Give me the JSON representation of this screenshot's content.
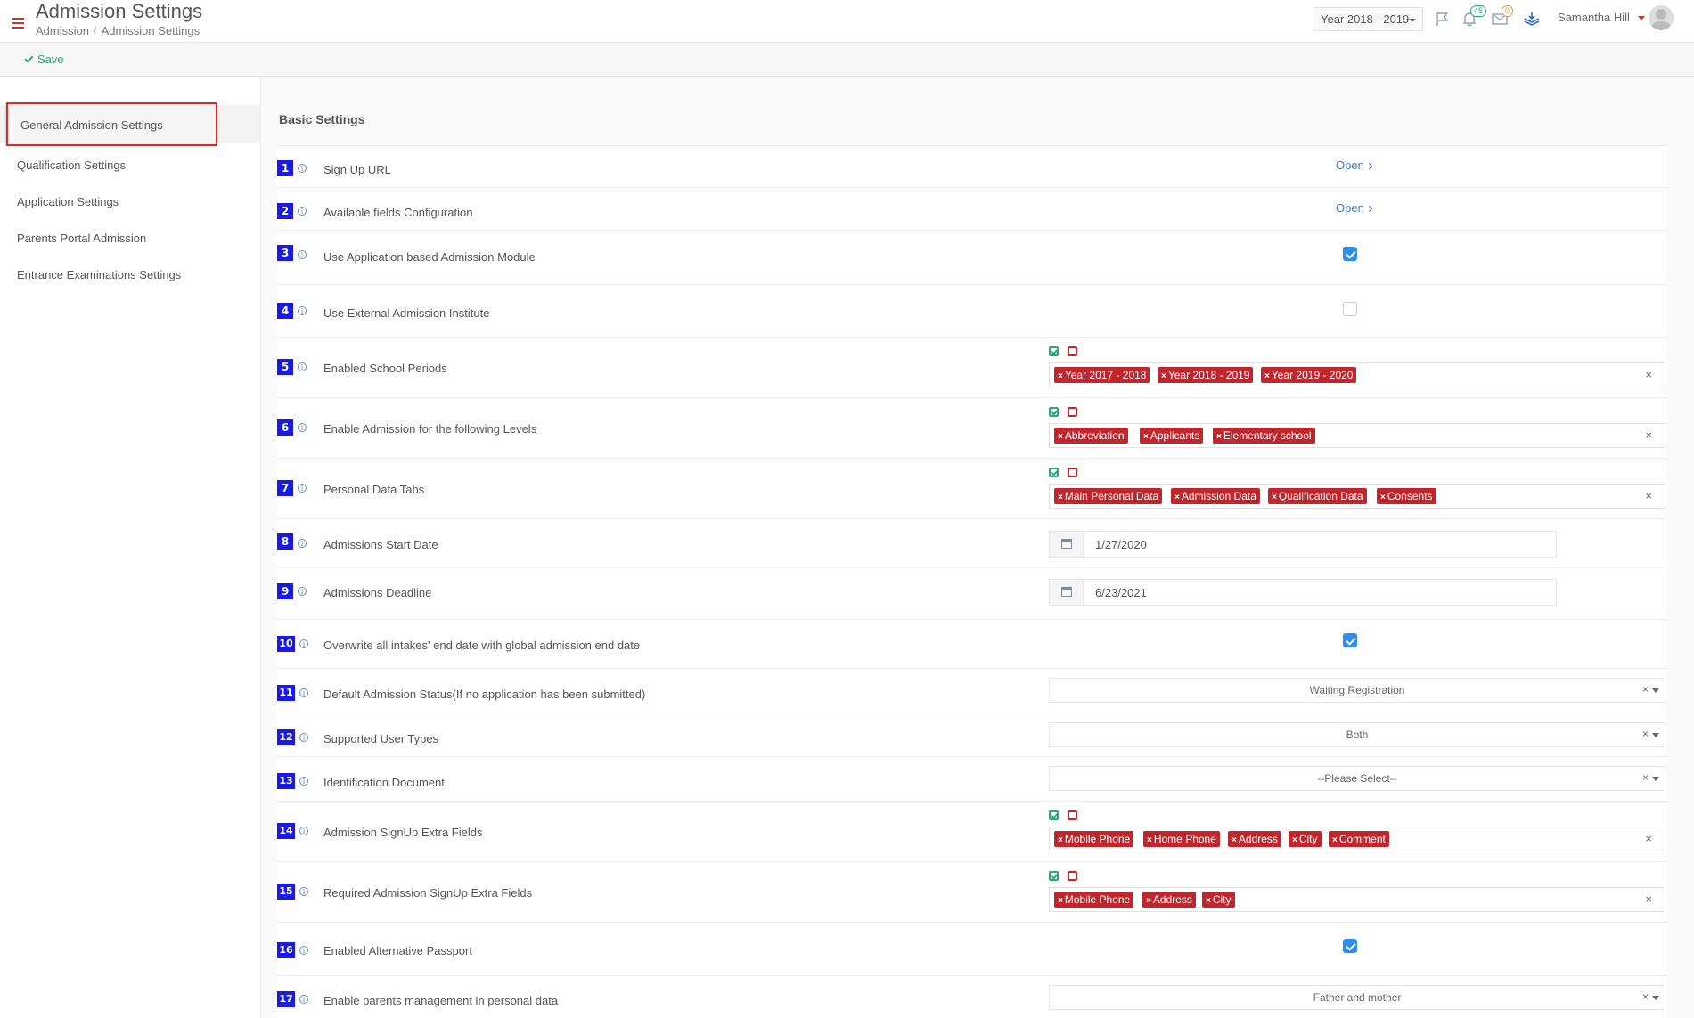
{
  "header": {
    "title": "Admission Settings",
    "breadcrumb": [
      "Admission",
      "Admission Settings"
    ],
    "year_select": "Year 2018 - 2019",
    "notifications_count": "45",
    "messages_count": "0",
    "user_name": "Samantha Hill"
  },
  "toolbar": {
    "save_label": "Save"
  },
  "sidebar": {
    "items": [
      {
        "label": "General Admission Settings"
      },
      {
        "label": "Qualification Settings"
      },
      {
        "label": "Application Settings"
      },
      {
        "label": "Parents Portal Admission"
      },
      {
        "label": "Entrance Examinations Settings"
      }
    ]
  },
  "main": {
    "section_title": "Basic Settings",
    "open_label": "Open",
    "rows": [
      {
        "num": "1",
        "label": "Sign Up URL"
      },
      {
        "num": "2",
        "label": "Available fields Configuration"
      },
      {
        "num": "3",
        "label": "Use Application based Admission Module",
        "checked": true
      },
      {
        "num": "4",
        "label": "Use External Admission Institute",
        "checked": false
      },
      {
        "num": "5",
        "label": "Enabled School Periods",
        "tags": [
          "Year 2017 - 2018",
          "Year 2018 - 2019",
          "Year 2019 - 2020"
        ]
      },
      {
        "num": "6",
        "label": "Enable Admission for the following Levels",
        "tags": [
          "Abbreviation",
          "Applicants",
          "Elementary school"
        ]
      },
      {
        "num": "7",
        "label": "Personal Data Tabs",
        "tags": [
          "Main Personal Data",
          "Admission Data",
          "Qualification Data",
          "Consents"
        ]
      },
      {
        "num": "8",
        "label": "Admissions Start Date",
        "date": "1/27/2020"
      },
      {
        "num": "9",
        "label": "Admissions Deadline",
        "date": "6/23/2021"
      },
      {
        "num": "10",
        "label": "Overwrite all intakes' end date with global admission end date",
        "checked": true
      },
      {
        "num": "11",
        "label": "Default Admission Status(If no application has been submitted)",
        "select": "Waiting Registration"
      },
      {
        "num": "12",
        "label": "Supported User Types",
        "select": "Both"
      },
      {
        "num": "13",
        "label": "Identification Document",
        "select": "--Please Select--"
      },
      {
        "num": "14",
        "label": "Admission SignUp Extra Fields",
        "tags": [
          "Mobile Phone",
          "Home Phone",
          "Address",
          "City",
          "Comment"
        ]
      },
      {
        "num": "15",
        "label": "Required Admission SignUp Extra Fields",
        "tags": [
          "Mobile Phone",
          "Address",
          "City"
        ]
      },
      {
        "num": "16",
        "label": "Enabled Alternative Passport",
        "checked": true
      },
      {
        "num": "17",
        "label": "Enable parents management in personal data",
        "select": "Father and mother"
      }
    ]
  },
  "colors": {
    "accent": "#2aa876",
    "tag": "#c0262c",
    "number_badge": "#1a1ae6",
    "checkbox": "#2d8cf0"
  }
}
